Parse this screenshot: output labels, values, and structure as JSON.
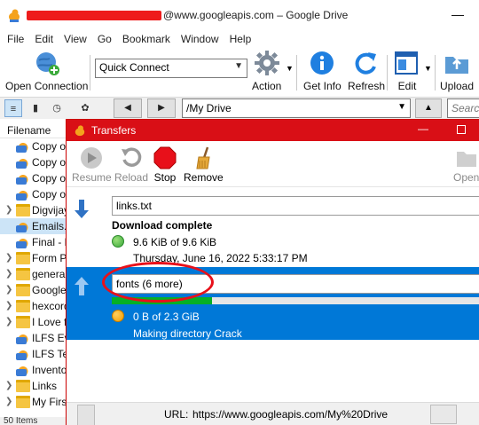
{
  "window": {
    "title_suffix": "@www.googleapis.com – Google Drive",
    "minimize_glyph": "—"
  },
  "menu": [
    "File",
    "Edit",
    "View",
    "Go",
    "Bookmark",
    "Window",
    "Help"
  ],
  "toolbar": {
    "open_connection": "Open Connection",
    "quick_connect": "Quick Connect",
    "action": "Action",
    "get_info": "Get Info",
    "refresh": "Refresh",
    "edit": "Edit",
    "upload": "Upload"
  },
  "pathbar": {
    "path": "/My Drive",
    "search_placeholder": "Search"
  },
  "file_list": {
    "header": "Filename",
    "items": [
      {
        "name": "Copy of",
        "icon": "duck-file-icon",
        "expandable": false,
        "selected": false
      },
      {
        "name": "Copy of",
        "icon": "duck-file-icon",
        "expandable": false,
        "selected": false
      },
      {
        "name": "Copy of",
        "icon": "duck-file-icon",
        "expandable": false,
        "selected": false
      },
      {
        "name": "Copy of",
        "icon": "duck-file-icon",
        "expandable": false,
        "selected": false
      },
      {
        "name": "Digvijay",
        "icon": "folder-icon",
        "expandable": true,
        "selected": false
      },
      {
        "name": "Emails.c",
        "icon": "duck-file-icon",
        "expandable": false,
        "selected": true
      },
      {
        "name": "Final - M",
        "icon": "duck-file-icon",
        "expandable": false,
        "selected": false
      },
      {
        "name": "Form P",
        "icon": "folder-icon",
        "expandable": true,
        "selected": false
      },
      {
        "name": "general",
        "icon": "folder-icon",
        "expandable": true,
        "selected": false
      },
      {
        "name": "Google",
        "icon": "folder-icon",
        "expandable": true,
        "selected": false
      },
      {
        "name": "hexcord",
        "icon": "folder-icon",
        "expandable": true,
        "selected": false
      },
      {
        "name": "I Love f",
        "icon": "folder-icon",
        "expandable": true,
        "selected": false
      },
      {
        "name": "ILFS Eve",
        "icon": "duck-file-icon",
        "expandable": false,
        "selected": false
      },
      {
        "name": "ILFS Tes",
        "icon": "duck-file-icon",
        "expandable": false,
        "selected": false
      },
      {
        "name": "Invento",
        "icon": "duck-file-icon",
        "expandable": false,
        "selected": false
      },
      {
        "name": "Links",
        "icon": "folder-icon",
        "expandable": true,
        "selected": false
      },
      {
        "name": "My First",
        "icon": "folder-icon",
        "expandable": true,
        "selected": false
      }
    ],
    "status": "50 Items"
  },
  "transfers": {
    "title": "Transfers",
    "toolbar": {
      "resume": "Resume",
      "reload": "Reload",
      "stop": "Stop",
      "remove": "Remove",
      "open": "Open"
    },
    "items": [
      {
        "filename": "links.txt",
        "status": "Download complete",
        "size": "9.6 KiB of 9.6 KiB",
        "date": "Thursday, June 16, 2022 5:33:17 PM"
      },
      {
        "filename": "fonts (6 more)",
        "progress_fraction": 0.27,
        "size": "0 B of 2.3 GiB",
        "message": "Making directory Crack"
      }
    ],
    "footer": {
      "url_label": "URL:",
      "url_value": "https://www.googleapis.com/My%20Drive"
    }
  },
  "colors": {
    "transfers_title_bg": "#d90f16",
    "selected_transfer_bg": "#0078d7",
    "progress_fill": "#06b025",
    "highlight_ellipse": "#e8101a"
  }
}
